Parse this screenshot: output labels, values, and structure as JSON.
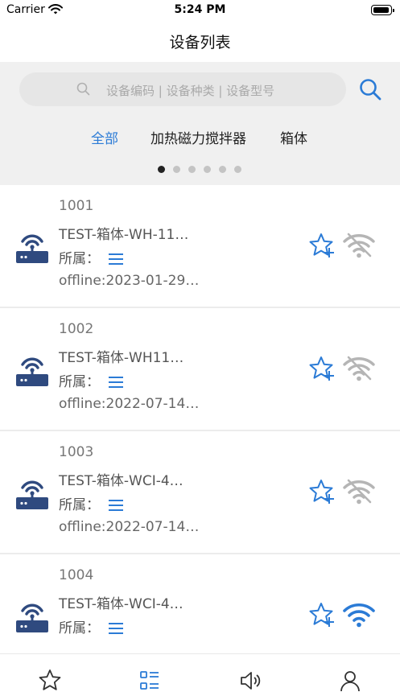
{
  "status_bar": {
    "carrier": "Carrier",
    "time": "5:24 PM"
  },
  "nav": {
    "title": "设备列表"
  },
  "search": {
    "placeholder": "设备编码 | 设备种类 | 设备型号"
  },
  "category_tabs": [
    {
      "label": "全部",
      "active": true
    },
    {
      "label": "加热磁力搅拌器",
      "active": false
    },
    {
      "label": "箱体",
      "active": false
    }
  ],
  "pager": {
    "count": 6,
    "active_index": 0
  },
  "owner_label": "所属：",
  "devices": [
    {
      "code": "1001",
      "name": "TEST-箱体-WH-11…",
      "status": "offline:2023-01-29…",
      "online": false
    },
    {
      "code": "1002",
      "name": "TEST-箱体-WH11…",
      "status": "offline:2022-07-14…",
      "online": false
    },
    {
      "code": "1003",
      "name": "TEST-箱体-WCI-4…",
      "status": "offline:2022-07-14…",
      "online": false
    },
    {
      "code": "1004",
      "name": "TEST-箱体-WCI-4…",
      "status": "",
      "online": true
    }
  ],
  "tab_bar": [
    {
      "icon": "star-icon",
      "active": false
    },
    {
      "icon": "list-icon",
      "active": true
    },
    {
      "icon": "speaker-icon",
      "active": false
    },
    {
      "icon": "user-icon",
      "active": false
    }
  ],
  "colors": {
    "accent": "#2b7bd6",
    "device_icon": "#2f4a7f",
    "wifi_offline": "#b5b5b5",
    "wifi_online": "#2b7bd6"
  }
}
